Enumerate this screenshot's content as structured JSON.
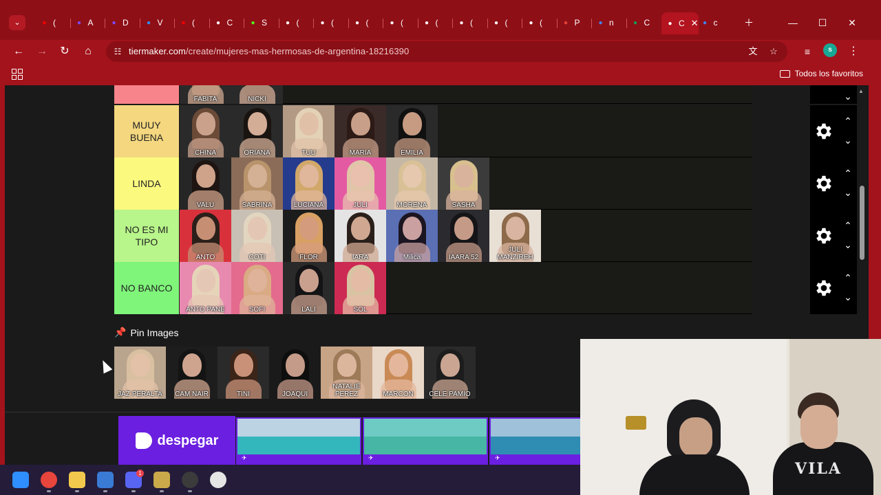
{
  "browser": {
    "tabs": [
      {
        "favicon": "youtube-icon",
        "label": "(",
        "color": "#ff0000"
      },
      {
        "favicon": "ai-icon",
        "label": "A",
        "color": "#7b4cff"
      },
      {
        "favicon": "ai-icon",
        "label": "D",
        "color": "#7b4cff"
      },
      {
        "favicon": "check-icon",
        "label": "V",
        "color": "#2f8fff"
      },
      {
        "favicon": "youtube-icon",
        "label": "(",
        "color": "#ff0000"
      },
      {
        "favicon": "openai-icon",
        "label": "C",
        "color": "#ffffff"
      },
      {
        "favicon": "kick-icon",
        "label": "S",
        "color": "#53fc18"
      },
      {
        "favicon": "tiktok-icon",
        "label": "(",
        "color": "#ffffff"
      },
      {
        "favicon": "tiktok-icon",
        "label": "(",
        "color": "#ffffff"
      },
      {
        "favicon": "tiktok-icon",
        "label": "(",
        "color": "#ffffff"
      },
      {
        "favicon": "tiktok-icon",
        "label": "(",
        "color": "#ffffff"
      },
      {
        "favicon": "tiktok-icon",
        "label": "(",
        "color": "#ffffff"
      },
      {
        "favicon": "tiktok-icon",
        "label": "(",
        "color": "#ffffff"
      },
      {
        "favicon": "tiktok-icon",
        "label": "(",
        "color": "#ffffff"
      },
      {
        "favicon": "tiktok-icon",
        "label": "(",
        "color": "#ffffff"
      },
      {
        "favicon": "gmail-icon",
        "label": "P",
        "color": "#ea4335"
      },
      {
        "favicon": "google-icon",
        "label": "n",
        "color": "#4285f4"
      },
      {
        "favicon": "sheets-icon",
        "label": "C",
        "color": "#0f9d58"
      },
      {
        "favicon": "tiermaker-icon",
        "label": "C",
        "color": "#ffffff",
        "active": true
      },
      {
        "favicon": "google-icon",
        "label": "c",
        "color": "#4285f4"
      }
    ],
    "address": {
      "host": "tiermaker.com",
      "path": "/create/mujeres-mas-hermosas-de-argentina-18216390"
    },
    "bookmarks_folder": "Todos los favoritos",
    "profile_initial": "s"
  },
  "tiers": [
    {
      "label": "MUUY BUENA",
      "color": "#f4d77f",
      "items": [
        {
          "name": "CHINA",
          "palette": [
            "#6b4a38",
            "#caa28c",
            "#2a2a2a"
          ]
        },
        {
          "name": "ORIANA",
          "palette": [
            "#1a1411",
            "#d3ad96",
            "#2a2a2a"
          ]
        },
        {
          "name": "TUU",
          "palette": [
            "#e4d2b7",
            "#e0c1a8",
            "#b39a84"
          ]
        },
        {
          "name": "MARIA",
          "palette": [
            "#2b1a16",
            "#c89f88",
            "#3a2a28"
          ]
        },
        {
          "name": "EMILIA",
          "palette": [
            "#101010",
            "#c79a82",
            "#2a2a2a"
          ]
        }
      ]
    },
    {
      "label": "LINDA",
      "color": "#fbfa7f",
      "items": [
        {
          "name": "VALU",
          "palette": [
            "#1e1512",
            "#cfa28a",
            "#262626"
          ]
        },
        {
          "name": "SABRINA",
          "palette": [
            "#b9936b",
            "#d4b094",
            "#8b6c58"
          ]
        },
        {
          "name": "LUCIANA",
          "palette": [
            "#d2a86a",
            "#e0b79b",
            "#253b8d"
          ]
        },
        {
          "name": "JULI",
          "palette": [
            "#e1c5a8",
            "#e8c0ad",
            "#e45aa2"
          ]
        },
        {
          "name": "MORENA",
          "palette": [
            "#d9c096",
            "#e5c8ad",
            "#c4b7a6"
          ]
        },
        {
          "name": "SASHA",
          "palette": [
            "#d8bf8e",
            "#d9b39c",
            "#3b3b3b"
          ]
        }
      ]
    },
    {
      "label": "NO ES MI TIPO",
      "color": "#b8f58a",
      "items": [
        {
          "name": "ANTO",
          "palette": [
            "#2b1f1a",
            "#c68f74",
            "#d9313c"
          ]
        },
        {
          "name": "COTI",
          "palette": [
            "#e2d6c0",
            "#e3c7b4",
            "#c8c0b4"
          ]
        },
        {
          "name": "FLOR",
          "palette": [
            "#d9a064",
            "#d49c7c",
            "#1c1c1c"
          ]
        },
        {
          "name": "IARA",
          "palette": [
            "#2a1f1a",
            "#d0a892",
            "#e4e4e4"
          ]
        },
        {
          "name": "Milica",
          "palette": [
            "#1b1521",
            "#caa0a0",
            "#5a6fb4"
          ]
        },
        {
          "name": "IAARA 52",
          "palette": [
            "#151518",
            "#c59b88",
            "#2a2a2f"
          ]
        },
        {
          "name": "JULI MANZIREH",
          "palette": [
            "#8d6a4a",
            "#d9b4a0",
            "#e8dfd5"
          ]
        }
      ]
    },
    {
      "label": "NO BANCO",
      "color": "#7ff57a",
      "items": [
        {
          "name": "ANTO PANE",
          "palette": [
            "#e6d4b9",
            "#e5c7b5",
            "#e88ab0"
          ]
        },
        {
          "name": "SOFI",
          "palette": [
            "#d9aa84",
            "#dfb39a",
            "#e46b8d"
          ]
        },
        {
          "name": "LALI",
          "palette": [
            "#141416",
            "#c9a08e",
            "#2a2a2a"
          ]
        },
        {
          "name": "SOL",
          "palette": [
            "#d8c3a2",
            "#e4bca6",
            "#cc2a52"
          ]
        }
      ]
    }
  ],
  "partial_tier": {
    "color": "#f7848a",
    "items": [
      {
        "name": "FABITA",
        "palette": [
          "#8b6a52",
          "#cfa890",
          "#2a2a2a"
        ]
      },
      {
        "name": "NICKI",
        "palette": [
          "#2a1d1a",
          "#d4ae98",
          "#2a2a2a"
        ]
      }
    ]
  },
  "pin_images": {
    "label": "Pin Images",
    "items": [
      {
        "name": "JAZ PERALTA",
        "palette": [
          "#d8c0a0",
          "#e3c1a8",
          "#b9a48e"
        ]
      },
      {
        "name": "CAM NAIR",
        "palette": [
          "#141414",
          "#cfa48e",
          "#1d1d1d"
        ]
      },
      {
        "name": "TINI",
        "palette": [
          "#3b2418",
          "#c99278",
          "#2a2a2a"
        ]
      },
      {
        "name": "JOAQUI",
        "palette": [
          "#0e0e0e",
          "#c49a88",
          "#1a1a1a"
        ]
      },
      {
        "name": "NATALIE PEREZ",
        "palette": [
          "#9d7a58",
          "#dcb59d",
          "#c7a486"
        ]
      },
      {
        "name": "MARCON",
        "palette": [
          "#c98a56",
          "#e4b79c",
          "#e9d7c8"
        ]
      },
      {
        "name": "CELE PAMIO",
        "palette": [
          "#1c1c1c",
          "#c9a592",
          "#2a2a2a"
        ]
      }
    ]
  },
  "ad": {
    "brand": "despegar"
  },
  "taskbar": {
    "apps": [
      "windows-start-icon",
      "chrome-icon",
      "file-explorer-icon",
      "store-icon",
      "discord-icon",
      "league-icon",
      "obs-icon",
      "app-icon"
    ],
    "discord_badge": "1"
  }
}
